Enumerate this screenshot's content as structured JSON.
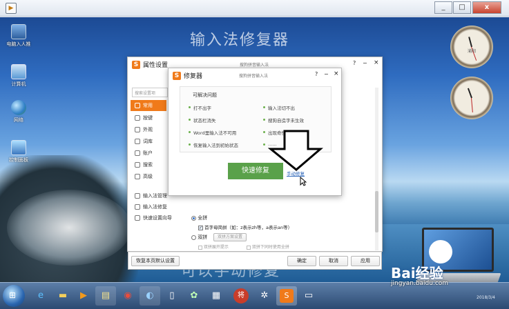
{
  "window": {
    "close_glyph": "x",
    "min_glyph": "_",
    "max_glyph": "□"
  },
  "desktop": {
    "icons": [
      {
        "label": "电脑入人推",
        "color": "#4a86c8"
      },
      {
        "label": "计算机",
        "color": "#5a9ad6"
      },
      {
        "label": "网络",
        "color": "#3b8a4e"
      },
      {
        "label": "控制面板",
        "color": "#3c78c0"
      }
    ],
    "watermark_top": "输入法修复器",
    "watermark_bottom": "可以手动修复",
    "clock1_label": "渝阳",
    "clock2_label": ""
  },
  "prop_dialog": {
    "title": "属性设置",
    "subtitle": "搜狗拼音输入法",
    "help": "?",
    "search_placeholder": "搜索设置项",
    "side_items": [
      {
        "label": "常用",
        "active": true
      },
      {
        "label": "按键",
        "active": false
      },
      {
        "label": "外观",
        "active": false
      },
      {
        "label": "词库",
        "active": false
      },
      {
        "label": "账户",
        "active": false
      },
      {
        "label": "搜索",
        "active": false
      },
      {
        "label": "高级",
        "active": false
      }
    ],
    "side_bottom": [
      {
        "label": "输入法管理"
      },
      {
        "label": "输入法修复"
      },
      {
        "label": "快速设置向导"
      }
    ],
    "option_quanpin": "全拼",
    "option_shouzimu": "首字母简拼（如：z表示zh等，a表示an等）",
    "option_shuangpin": "双拼",
    "shuangpin_settings": "双拼方案设置",
    "shuangpin_hint1": "双拼展开提示",
    "shuangpin_hint2": "双拼下同时使用全拼",
    "restore_button": "恢复本页默认设置",
    "ok_button": "确定",
    "cancel_button": "取消",
    "apply_button": "应用"
  },
  "repair_dialog": {
    "title": "修复器",
    "subtitle": "搜狗拼音输入法",
    "help": "?",
    "section_title": "可解决问题",
    "problems_left": [
      "打不出字",
      "状态栏消失",
      "Word里输入法不可用",
      "恢复输入法到初始状态"
    ],
    "problems_right": [
      "输入法切不出",
      "搜狗自造字未生效",
      "出现奇怪的错误",
      "......"
    ],
    "quick_repair_button": "快速修复",
    "manual_repair_link": "手动修复"
  },
  "taskbar": {
    "start_label": "开始",
    "clock_text": "2018/3/4"
  },
  "brand": {
    "baidu_text": "Bai经验",
    "baidu_url": "jingyan.baidu.com"
  },
  "colors": {
    "accent": "#f07a1a",
    "quick_repair": "#5aa14a",
    "link": "#2a64b8"
  }
}
